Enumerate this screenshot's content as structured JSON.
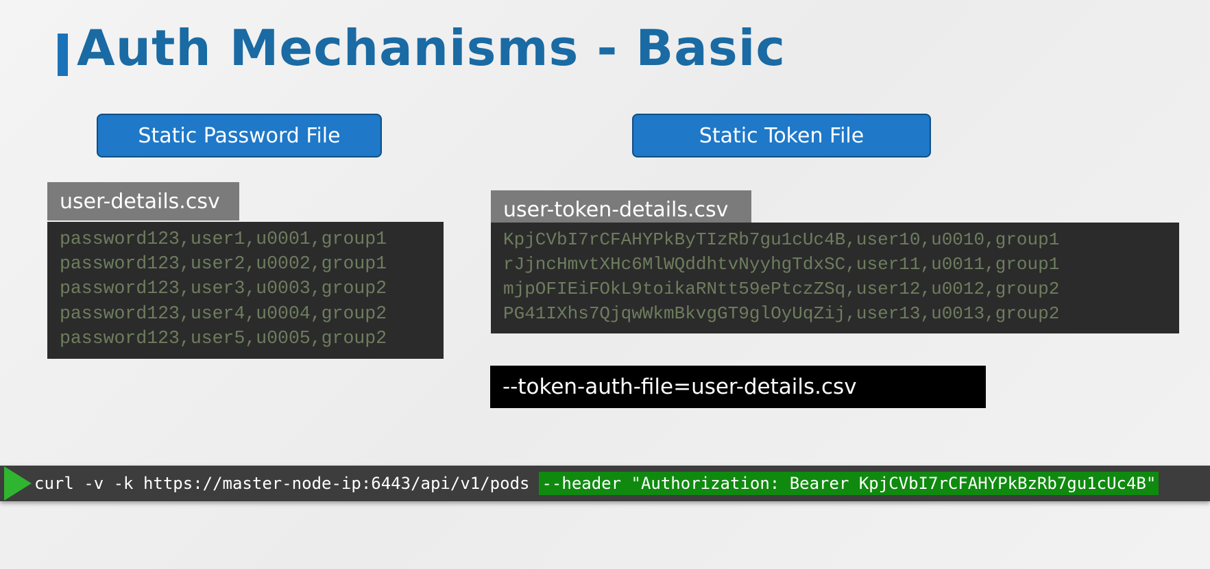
{
  "title": "Auth Mechanisms - Basic",
  "left_panel": {
    "heading": "Static Password File",
    "file_name": "user-details.csv",
    "lines": [
      "password123,user1,u0001,group1",
      "password123,user2,u0002,group1",
      "password123,user3,u0003,group2",
      "password123,user4,u0004,group2",
      "password123,user5,u0005,group2"
    ]
  },
  "right_panel": {
    "heading": "Static Token File",
    "file_name": "user-token-details.csv",
    "lines": [
      "KpjCVbI7rCFAHYPkByTIzRb7gu1cUc4B,user10,u0010,group1",
      "rJjncHmvtXHc6MlWQddhtvNyyhgTdxSC,user11,u0011,group1",
      "mjpOFIEiFOkL9toikaRNtt59ePtczZSq,user12,u0012,group2",
      "PG41IXhs7QjqwWkmBkvgGT9glOyUqZij,user13,u0013,group2"
    ],
    "flag": "--token-auth-file=user-details.csv"
  },
  "terminal": {
    "icon": "play-icon",
    "command": "curl -v -k https://master-node-ip:6443/api/v1/pods",
    "highlighted": "--header \"Authorization: Bearer KpjCVbI7rCFAHYPkBzRb7gu1cUc4B\""
  },
  "colors": {
    "title": "#1a6aa3",
    "accent": "#1f78c8",
    "code_text": "#6e7d5e",
    "highlight": "#0f8a0f"
  }
}
